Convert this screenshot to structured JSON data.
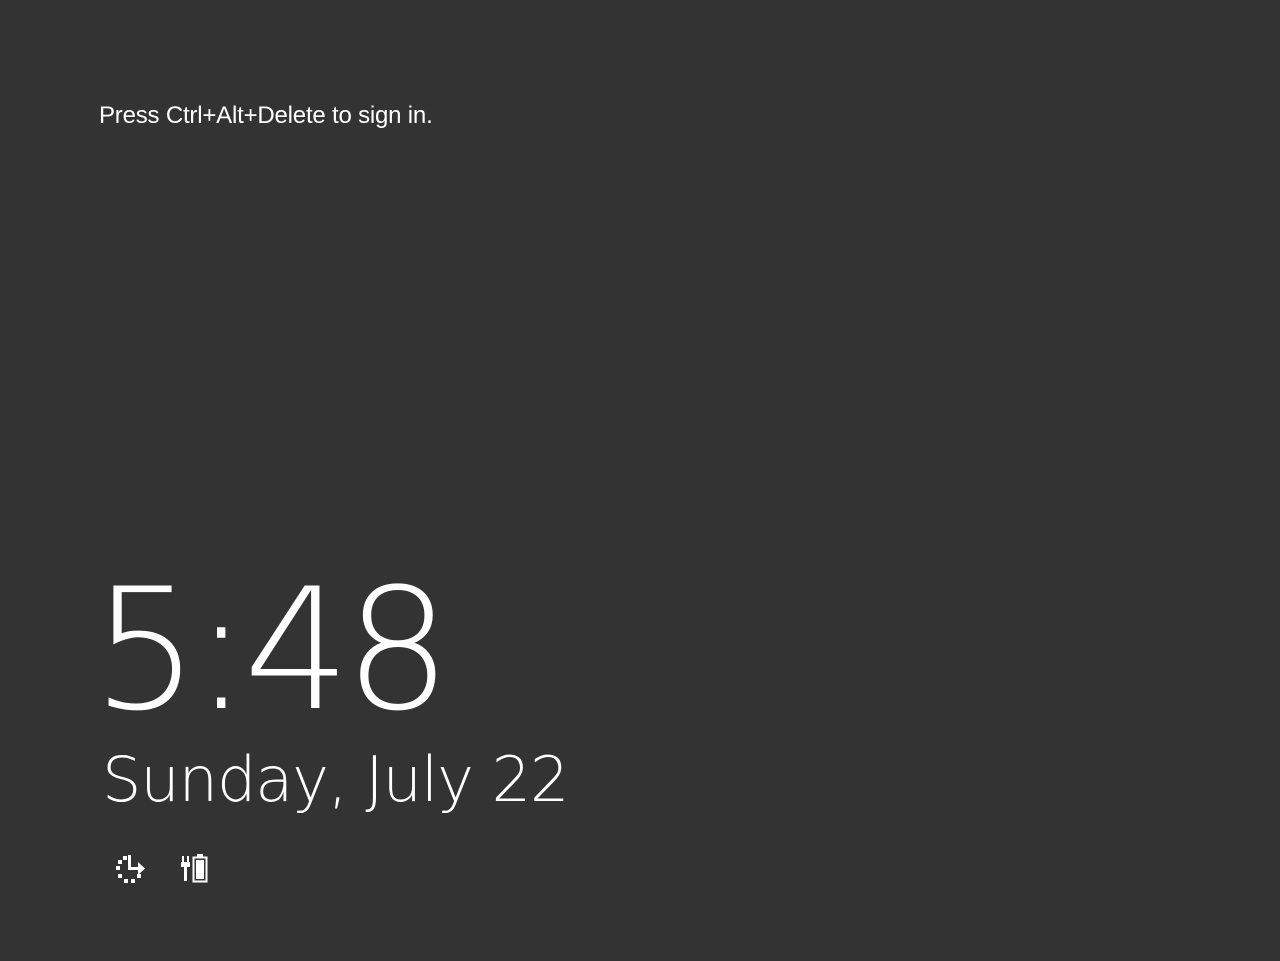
{
  "lock_screen": {
    "signin_prompt": "Press Ctrl+Alt+Delete to sign in.",
    "time": "5:48",
    "date": "Sunday, July 22",
    "status_icons": [
      {
        "icon": "network-icon"
      },
      {
        "icon": "battery-charging-icon"
      }
    ],
    "colors": {
      "background": "#333333",
      "text": "#ffffff"
    }
  }
}
